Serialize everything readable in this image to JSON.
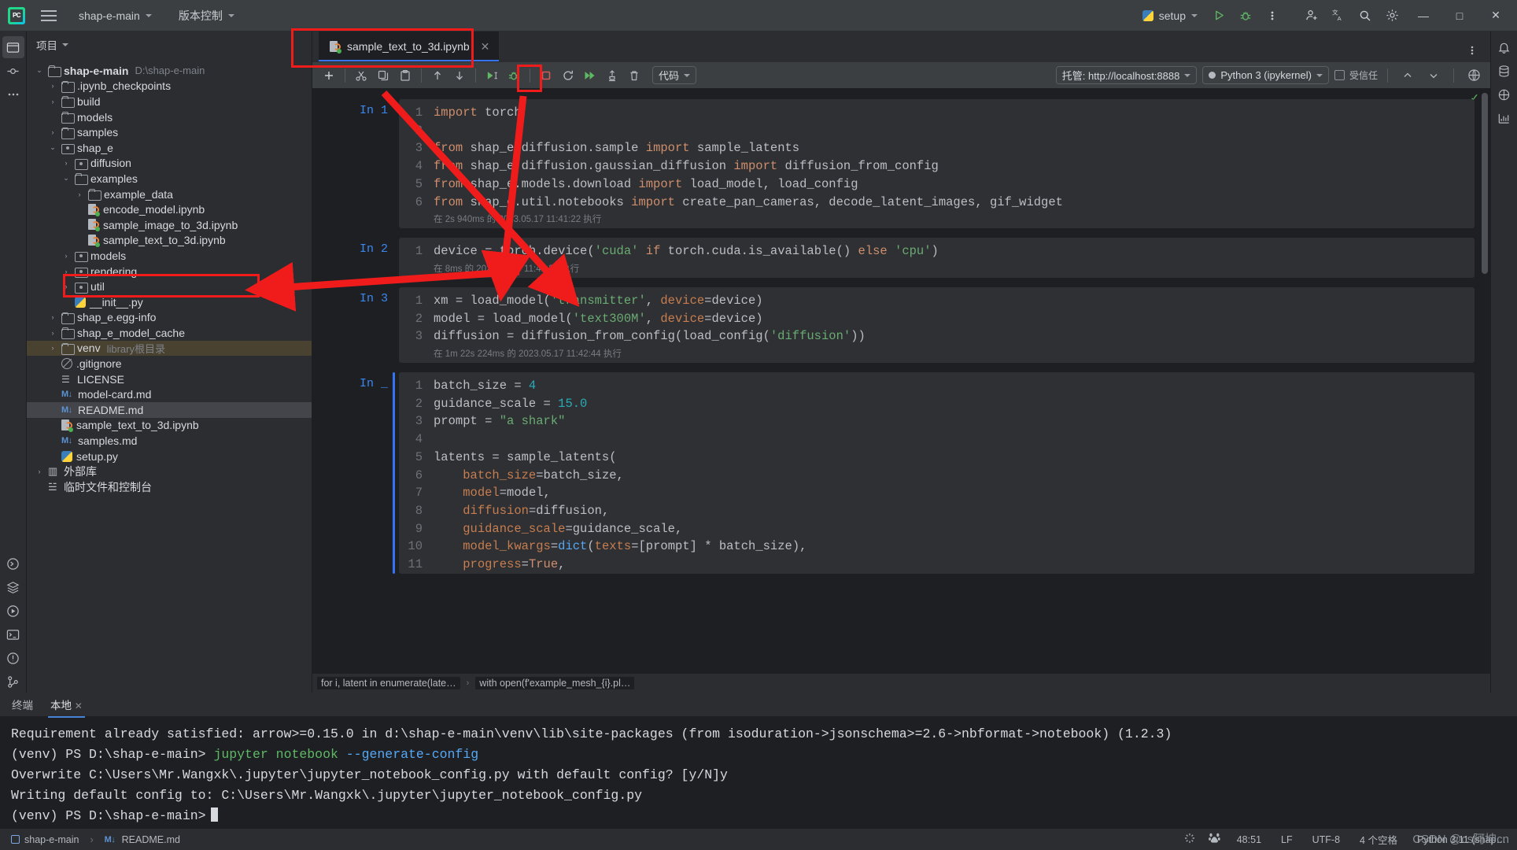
{
  "titlebar": {
    "logo": "pycharm-logo",
    "project_name": "shap-e-main",
    "vcs_label": "版本控制",
    "run_config": "setup",
    "minimize": "—",
    "maximize": "□",
    "close": "✕"
  },
  "project_panel": {
    "title": "项目",
    "tree": [
      {
        "depth": 0,
        "arrow": "v",
        "icon": "folder",
        "name": "shap-e-main",
        "bold": true,
        "path": "D:\\shap-e-main"
      },
      {
        "depth": 1,
        "arrow": ">",
        "icon": "folder",
        "name": ".ipynb_checkpoints"
      },
      {
        "depth": 1,
        "arrow": ">",
        "icon": "folder",
        "name": "build"
      },
      {
        "depth": 1,
        "arrow": "",
        "icon": "folder",
        "name": "models"
      },
      {
        "depth": 1,
        "arrow": ">",
        "icon": "folder",
        "name": "samples"
      },
      {
        "depth": 1,
        "arrow": "v",
        "icon": "package",
        "name": "shap_e"
      },
      {
        "depth": 2,
        "arrow": ">",
        "icon": "package",
        "name": "diffusion"
      },
      {
        "depth": 2,
        "arrow": "v",
        "icon": "folder",
        "name": "examples"
      },
      {
        "depth": 3,
        "arrow": ">",
        "icon": "folder",
        "name": "example_data"
      },
      {
        "depth": 3,
        "arrow": "",
        "icon": "ipynb",
        "name": "encode_model.ipynb"
      },
      {
        "depth": 3,
        "arrow": "",
        "icon": "ipynb",
        "name": "sample_image_to_3d.ipynb"
      },
      {
        "depth": 3,
        "arrow": "",
        "icon": "ipynb",
        "name": "sample_text_to_3d.ipynb",
        "highlight": true
      },
      {
        "depth": 2,
        "arrow": ">",
        "icon": "package",
        "name": "models"
      },
      {
        "depth": 2,
        "arrow": ">",
        "icon": "package",
        "name": "rendering"
      },
      {
        "depth": 2,
        "arrow": ">",
        "icon": "package",
        "name": "util"
      },
      {
        "depth": 2,
        "arrow": "",
        "icon": "py",
        "name": "__init__.py"
      },
      {
        "depth": 1,
        "arrow": ">",
        "icon": "folder",
        "name": "shap_e.egg-info"
      },
      {
        "depth": 1,
        "arrow": ">",
        "icon": "folder",
        "name": "shap_e_model_cache"
      },
      {
        "depth": 1,
        "arrow": ">",
        "icon": "folder",
        "name": "venv",
        "path": "library根目录",
        "venv": true
      },
      {
        "depth": 1,
        "arrow": "",
        "icon": "gitignore",
        "name": ".gitignore"
      },
      {
        "depth": 1,
        "arrow": "",
        "icon": "license",
        "name": "LICENSE"
      },
      {
        "depth": 1,
        "arrow": "",
        "icon": "md",
        "name": "model-card.md"
      },
      {
        "depth": 1,
        "arrow": "",
        "icon": "md",
        "name": "README.md",
        "selected": true
      },
      {
        "depth": 1,
        "arrow": "",
        "icon": "ipynb",
        "name": "sample_text_to_3d.ipynb"
      },
      {
        "depth": 1,
        "arrow": "",
        "icon": "md",
        "name": "samples.md"
      },
      {
        "depth": 1,
        "arrow": "",
        "icon": "py",
        "name": "setup.py"
      },
      {
        "depth": 0,
        "arrow": ">",
        "icon": "lib",
        "name": "外部库"
      },
      {
        "depth": 0,
        "arrow": "",
        "icon": "scratch",
        "name": "临时文件和控制台"
      }
    ]
  },
  "editor": {
    "tab": {
      "label": "sample_text_to_3d.ipynb",
      "close": "✕"
    },
    "toolbar": {
      "add": "add-cell",
      "cut": "cut",
      "copy": "copy",
      "paste": "paste",
      "move_up": "move-cell-up",
      "move_down": "move-cell-down",
      "run": "run-cell",
      "debug": "debug-cell",
      "stop": "interrupt-kernel",
      "restart": "restart-kernel",
      "run_all": "run-all-cells",
      "clear": "clear-outputs",
      "delete": "delete-cell",
      "cell_type": "代码",
      "server": "托管: http://localhost:8888",
      "kernel": "Python 3 (ipykernel)",
      "trusted": "受信任",
      "prev_cell": "^",
      "next_cell": "v",
      "browser": "open-in-browser"
    },
    "cells": [
      {
        "label": "In 1",
        "lines": [
          [
            {
              "t": "import ",
              "c": "kw"
            },
            {
              "t": "torch",
              "c": "plain"
            }
          ],
          [],
          [
            {
              "t": "from ",
              "c": "kw"
            },
            {
              "t": "shap_e.diffusion.sample ",
              "c": "plain"
            },
            {
              "t": "import ",
              "c": "kw"
            },
            {
              "t": "sample_latents",
              "c": "plain"
            }
          ],
          [
            {
              "t": "from ",
              "c": "kw"
            },
            {
              "t": "shap_e.diffusion.gaussian_diffusion ",
              "c": "plain"
            },
            {
              "t": "import ",
              "c": "kw"
            },
            {
              "t": "diffusion_from_config",
              "c": "plain"
            }
          ],
          [
            {
              "t": "from ",
              "c": "kw"
            },
            {
              "t": "shap_e.models.download ",
              "c": "plain"
            },
            {
              "t": "import ",
              "c": "kw"
            },
            {
              "t": "load_model, load_config",
              "c": "plain"
            }
          ],
          [
            {
              "t": "from ",
              "c": "kw"
            },
            {
              "t": "shap_e.util.notebooks ",
              "c": "plain"
            },
            {
              "t": "import ",
              "c": "kw"
            },
            {
              "t": "create_pan_cameras, decode_latent_images, gif_widget",
              "c": "plain"
            }
          ]
        ],
        "exec_info": "在 2s 940ms 的 2023.05.17 11:41:22 执行"
      },
      {
        "label": "In 2",
        "lines": [
          [
            {
              "t": "device = torch.device(",
              "c": "plain"
            },
            {
              "t": "'cuda'",
              "c": "str"
            },
            {
              "t": " ",
              "c": "plain"
            },
            {
              "t": "if ",
              "c": "kw"
            },
            {
              "t": "torch.cuda.is_available() ",
              "c": "plain"
            },
            {
              "t": "else ",
              "c": "kw"
            },
            {
              "t": "'cpu'",
              "c": "str"
            },
            {
              "t": ")",
              "c": "plain"
            }
          ]
        ],
        "exec_info": "在 8ms 的 2023.05.17 11:41:22 执行"
      },
      {
        "label": "In 3",
        "lines": [
          [
            {
              "t": "xm = load_model(",
              "c": "plain"
            },
            {
              "t": "'transmitter'",
              "c": "str"
            },
            {
              "t": ", ",
              "c": "plain"
            },
            {
              "t": "device",
              "c": "param"
            },
            {
              "t": "=device)",
              "c": "plain"
            }
          ],
          [
            {
              "t": "model = load_model(",
              "c": "plain"
            },
            {
              "t": "'text300M'",
              "c": "str"
            },
            {
              "t": ", ",
              "c": "plain"
            },
            {
              "t": "device",
              "c": "param"
            },
            {
              "t": "=device)",
              "c": "plain"
            }
          ],
          [
            {
              "t": "diffusion = diffusion_from_config(load_config(",
              "c": "plain"
            },
            {
              "t": "'diffusion'",
              "c": "str"
            },
            {
              "t": "))",
              "c": "plain"
            }
          ]
        ],
        "exec_info": "在 1m 22s 224ms 的 2023.05.17 11:42:44 执行"
      },
      {
        "label": "In _",
        "active": true,
        "lines": [
          [
            {
              "t": "batch_size = ",
              "c": "plain"
            },
            {
              "t": "4",
              "c": "num"
            }
          ],
          [
            {
              "t": "guidance_scale = ",
              "c": "plain"
            },
            {
              "t": "15.0",
              "c": "num"
            }
          ],
          [
            {
              "t": "prompt = ",
              "c": "plain"
            },
            {
              "t": "\"a shark\"",
              "c": "str"
            }
          ],
          [],
          [
            {
              "t": "latents = sample_latents(",
              "c": "plain"
            }
          ],
          [
            {
              "t": "    ",
              "c": "plain"
            },
            {
              "t": "batch_size",
              "c": "param"
            },
            {
              "t": "=batch_size,",
              "c": "plain"
            }
          ],
          [
            {
              "t": "    ",
              "c": "plain"
            },
            {
              "t": "model",
              "c": "param"
            },
            {
              "t": "=model,",
              "c": "plain"
            }
          ],
          [
            {
              "t": "    ",
              "c": "plain"
            },
            {
              "t": "diffusion",
              "c": "param"
            },
            {
              "t": "=diffusion,",
              "c": "plain"
            }
          ],
          [
            {
              "t": "    ",
              "c": "plain"
            },
            {
              "t": "guidance_scale",
              "c": "param"
            },
            {
              "t": "=guidance_scale,",
              "c": "plain"
            }
          ],
          [
            {
              "t": "    ",
              "c": "plain"
            },
            {
              "t": "model_kwargs",
              "c": "param"
            },
            {
              "t": "=",
              "c": "plain"
            },
            {
              "t": "dict",
              "c": "fn"
            },
            {
              "t": "(",
              "c": "plain"
            },
            {
              "t": "texts",
              "c": "param"
            },
            {
              "t": "=[prompt] * batch_size),",
              "c": "plain"
            }
          ],
          [
            {
              "t": "    ",
              "c": "plain"
            },
            {
              "t": "progress",
              "c": "param"
            },
            {
              "t": "=",
              "c": "plain"
            },
            {
              "t": "True",
              "c": "kw"
            },
            {
              "t": ",",
              "c": "plain"
            }
          ]
        ],
        "exec_info": ""
      }
    ],
    "breadcrumb": [
      "for i, latent in enumerate(late…",
      "with open(f'example_mesh_{i}.pl…"
    ]
  },
  "terminal": {
    "tabs": [
      {
        "label": "终端",
        "active": false
      },
      {
        "label": "本地",
        "active": true,
        "close": "✕"
      }
    ],
    "lines": [
      [
        {
          "t": "Requirement already satisfied: arrow>=0.15.0 in d:\\shap-e-main\\venv\\lib\\site-packages (from isoduration->jsonschema>=2.6->nbformat->notebook) (1.2.3)",
          "c": ""
        }
      ],
      [
        {
          "t": "(venv) PS D:\\shap-e-main> ",
          "c": ""
        },
        {
          "t": "jupyter notebook ",
          "c": "tgreen"
        },
        {
          "t": "--generate-config",
          "c": "tblue"
        }
      ],
      [
        {
          "t": "Overwrite C:\\Users\\Mr.Wangxk\\.jupyter\\jupyter_notebook_config.py with default config? [y/N]y",
          "c": ""
        }
      ],
      [
        {
          "t": "Writing default config to: C:\\Users\\Mr.Wangxk\\.jupyter\\jupyter_notebook_config.py",
          "c": ""
        }
      ],
      [
        {
          "t": "(venv) PS D:\\shap-e-main>",
          "c": ""
        }
      ]
    ]
  },
  "statusbar": {
    "left": [
      {
        "icon": "project-icon",
        "label": "shap-e-main"
      },
      {
        "icon": "md-icon",
        "label": "README.md"
      }
    ],
    "right": [
      "48:51",
      "LF",
      "UTF-8",
      "4 个空格",
      "Python 3.11 (shap…"
    ]
  },
  "watermark": "CSDN @cs阿坤cn",
  "colors": {
    "accent_blue": "#3574f0",
    "annotation_red": "#f01c1c",
    "green_run": "#5fb865",
    "string_green": "#6aab73",
    "keyword_orange": "#cf8e6d",
    "number_cyan": "#2aacb8",
    "venv_highlight": "#4a4231"
  }
}
